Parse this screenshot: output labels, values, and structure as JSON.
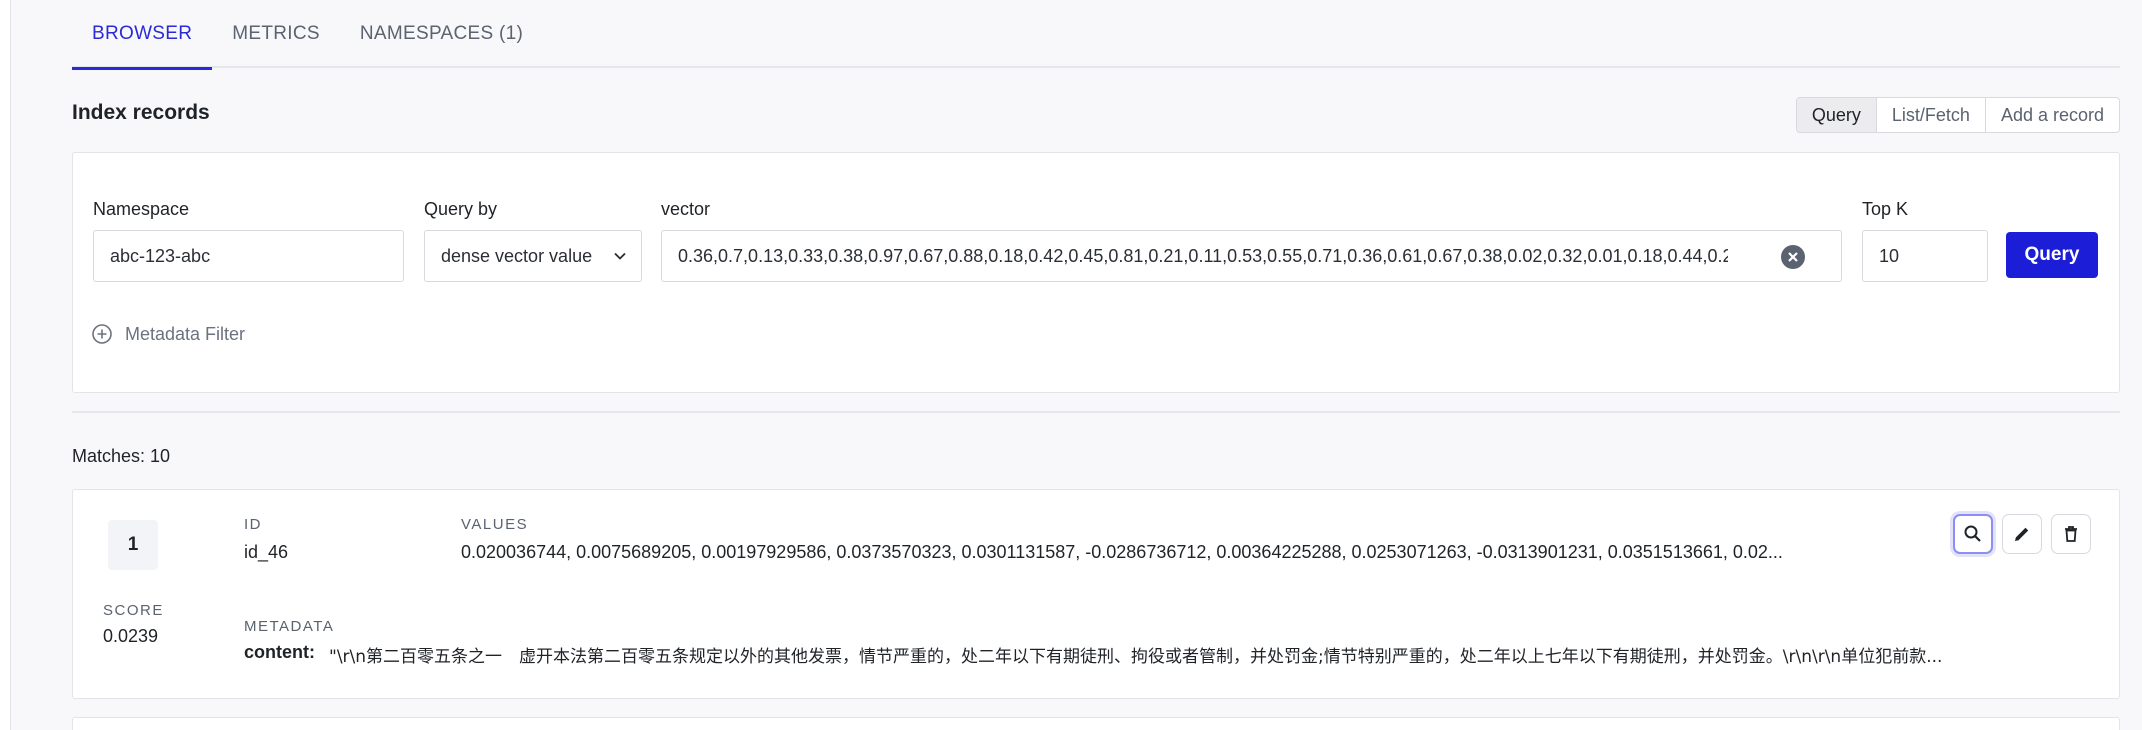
{
  "tabs": [
    {
      "label": "BROWSER"
    },
    {
      "label": "METRICS"
    },
    {
      "label": "NAMESPACES (1)"
    }
  ],
  "section": {
    "title": "Index records"
  },
  "modes": [
    "Query",
    "List/Fetch",
    "Add a record"
  ],
  "query_form": {
    "namespace_label": "Namespace",
    "namespace_value": "abc-123-abc",
    "query_by_label": "Query by",
    "query_by_value": "dense vector value",
    "vector_label": "vector",
    "vector_value": "0.36,0.7,0.13,0.33,0.38,0.97,0.67,0.88,0.18,0.42,0.45,0.81,0.21,0.11,0.53,0.55,0.71,0.36,0.61,0.67,0.38,0.02,0.32,0.01,0.18,0.44,0.2",
    "topk_label": "Top K",
    "topk_value": "10",
    "query_button": "Query",
    "metadata_filter": "Metadata Filter"
  },
  "results": {
    "matches_text": "Matches: 10",
    "items": [
      {
        "rank": "1",
        "score_label": "SCORE",
        "score": "0.0239",
        "id_label": "ID",
        "id": "id_46",
        "values_label": "VALUES",
        "values": "0.020036744, 0.0075689205, 0.00197929586, 0.0373570323, 0.0301131587, -0.0286736712, 0.00364225288, 0.0253071263, -0.0313901231, 0.0351513661, 0.02...",
        "metadata_label": "METADATA",
        "content_key": "content:",
        "content_value": "\"\\r\\n第二百零五条之一　虚开本法第二百零五条规定以外的其他发票，情节严重的，处二年以下有期徒刑、拘役或者管制，并处罚金;情节特别严重的，处二年以上七年以下有期徒刑，并处罚金。\\r\\n\\r\\n单位犯前款..."
      }
    ]
  },
  "colors": {
    "accent": "#1c1dd6",
    "tab_active": "#2a2ad6"
  },
  "icons": [
    "clear-icon",
    "chevron-down-icon",
    "plus-circle-icon",
    "search-icon",
    "edit-icon",
    "trash-icon"
  ]
}
